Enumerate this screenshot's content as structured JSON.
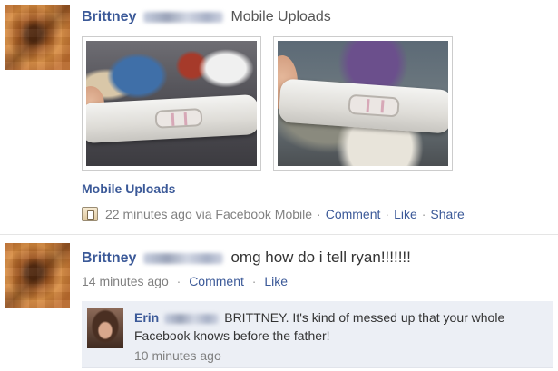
{
  "story1": {
    "author_first": "Brittney",
    "album_title": "Mobile Uploads",
    "album_link": "Mobile Uploads",
    "time": "22 minutes ago via Facebook Mobile",
    "actions": [
      "Comment",
      "Like",
      "Share"
    ]
  },
  "story2": {
    "author_first": "Brittney",
    "status": "omg how do i tell ryan!!!!!!!",
    "time": "14 minutes ago",
    "actions": [
      "Comment",
      "Like"
    ],
    "comment": {
      "author_first": "Erin",
      "text": "BRITTNEY. It's kind of messed up that your whole Facebook knows before the father!",
      "time": "10 minutes ago"
    }
  },
  "colors": {
    "link": "#3b5998",
    "muted": "#808080",
    "comment_bg": "#eceff5"
  },
  "icons": {
    "mobile_upload": "mobile-upload-icon"
  }
}
